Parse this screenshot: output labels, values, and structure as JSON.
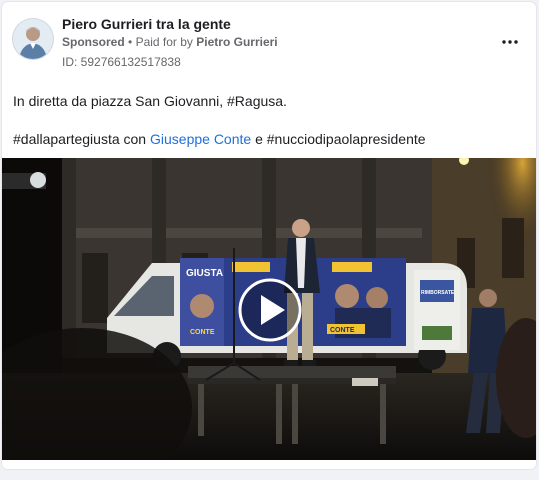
{
  "post": {
    "page_name": "Piero Gurrieri tra la gente",
    "sponsored_label": "Sponsored",
    "separator": "•",
    "paid_for_prefix": "Paid for by",
    "paid_for_name": "Pietro Gurrieri",
    "ad_id": "ID: 592766132517838",
    "more_icon": "more-horizontal-icon"
  },
  "content": {
    "line1": "In diretta da piazza San Giovanni, #Ragusa.",
    "line2_part1": "#dallapartegiusta con ",
    "line2_mention": "Giuseppe Conte",
    "line2_part2": " e #nucciodipaolapresidente"
  },
  "video": {
    "play_icon": "play-icon",
    "van_banner": {
      "giusta": "GIUSTA",
      "conte_left": "CONTE",
      "conte_right": "CONTE",
      "rimborsate": "RIMBORSATE"
    }
  },
  "colors": {
    "link": "#216fdb",
    "meta": "#65676b",
    "card": "#ffffff",
    "background": "#f0f2f5"
  }
}
